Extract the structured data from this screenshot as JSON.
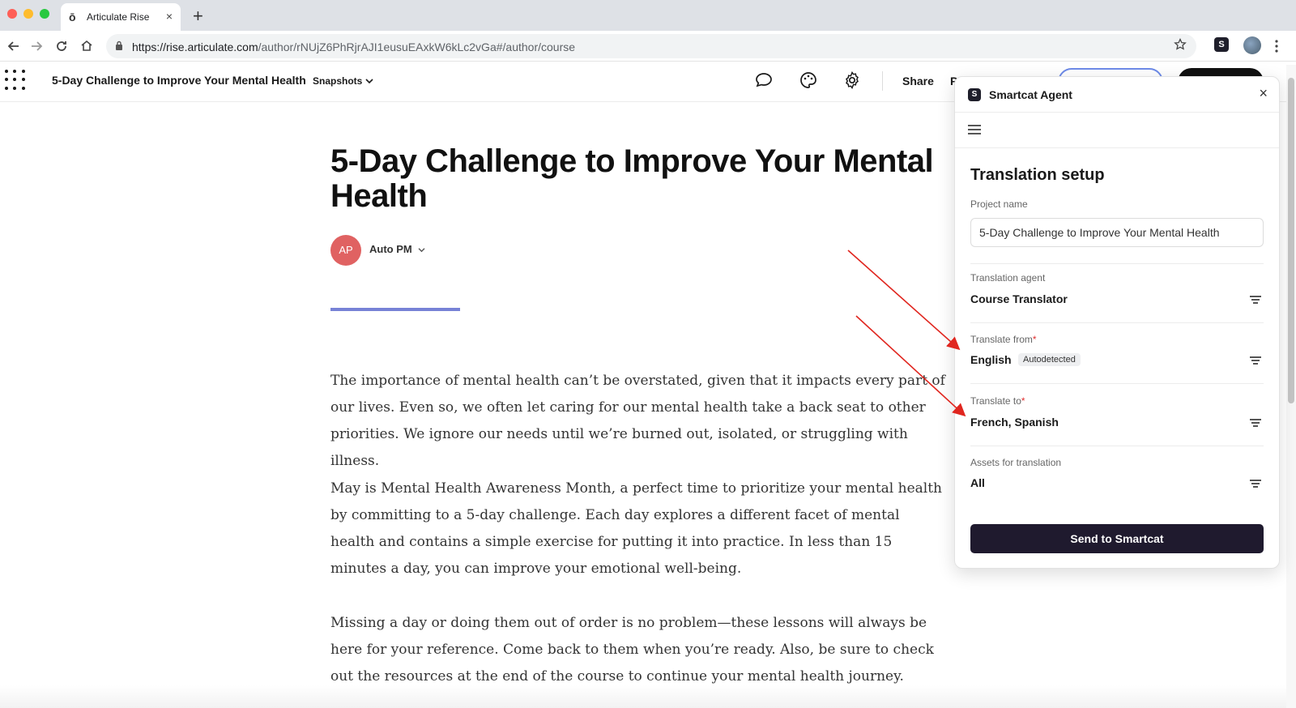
{
  "browser": {
    "tab_title": "Articulate Rise",
    "tab_favicon": "ō",
    "tab_close": "×",
    "new_tab": "+",
    "url_host": "https://rise.articulate.com",
    "url_path": "/author/rNUjZ6PhRjrAJI1eusuEAxkW6kLc2vGa#/author/course",
    "ext_label": "S"
  },
  "app_header": {
    "title": "5-Day Challenge to Improve Your Mental Health",
    "snapshots_label": "Snapshots",
    "share_label": "Share",
    "preview_partial": "P"
  },
  "course": {
    "title": "5-Day Challenge to Improve Your Mental Health",
    "author_initials": "AP",
    "author_name": "Auto PM",
    "paragraphs": [
      "The importance of mental health can’t be overstated, given that it impacts every part of our lives. Even so, we often let caring for our mental health take a back seat to other priorities. We ignore our needs until we’re burned out, isolated, or struggling with illness.",
      "May is Mental Health Awareness Month, a perfect time to prioritize your mental health by committing to a 5-day challenge. Each day explores a different facet of mental health and contains a simple exercise for putting it into practice. In less than 15 minutes a day, you can improve your emotional well-being.",
      "Missing a day or doing them out of order is no problem—these lessons will always be here for your reference. Come back to them when you’re ready. Also, be sure to check out the resources at the end of the course to continue your mental health journey."
    ]
  },
  "panel": {
    "title": "Smartcat Agent",
    "logo_text": "S",
    "close": "×",
    "setup_title": "Translation setup",
    "project_name_label": "Project name",
    "project_name_value": "5-Day Challenge to Improve Your Mental Health",
    "agent_label": "Translation agent",
    "agent_value": "Course Translator",
    "from_label": "Translate from",
    "from_value": "English",
    "from_badge": "Autodetected",
    "to_label": "Translate to",
    "to_value": "French, Spanish",
    "assets_label": "Assets for translation",
    "assets_value": "All",
    "required_mark": "*",
    "send_label": "Send to Smartcat"
  },
  "colors": {
    "arrow": "#e0261f",
    "accent_bar": "#7782d6",
    "avatar": "#e06262",
    "send_button": "#1f1a2e"
  }
}
